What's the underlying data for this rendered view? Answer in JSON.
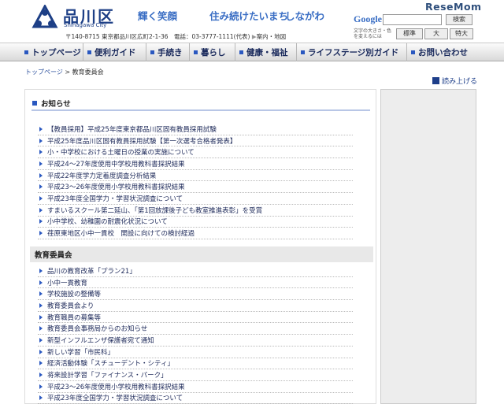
{
  "header": {
    "logo_name": "品川区",
    "logo_sub": "Shinagawa City",
    "slogan_1": "輝く笑顔",
    "slogan_2": "住み続けたいまち",
    "slogan_3": "しながわ",
    "address": "〒140-8715 東京都品川区広町2-1-36　電話：03-3777-1111(代表)",
    "address_link": "案内・地図",
    "google_label": "Google",
    "search_button": "検索",
    "font_size_label": "文字の大きさ・色を変えるには",
    "font_buttons": [
      "標準",
      "大",
      "特大"
    ],
    "watermark": "ReseMom"
  },
  "nav": {
    "items": [
      "トップページ",
      "便利ガイド",
      "手続き",
      "暮らし",
      "健康・福祉",
      "ライフステージ別ガイド",
      "お問い合わせ"
    ]
  },
  "breadcrumb": {
    "home": "トップページ",
    "separator": " > ",
    "current": "教育委員会"
  },
  "read_aloud": "読み上げる",
  "notices": {
    "title": "お知らせ",
    "items": [
      "【教員採用】平成25年度東京都品川区固有教員採用試験",
      "平成25年度品川区固有教員採用試験【第一次選考合格者発表】",
      "小・中学校における土曜日の授業の実施について",
      "平成24〜27年度使用中学校用教科書採択結果",
      "平成22年度学力定着度調査分析結果",
      "平成23〜26年度使用小学校用教科書採択結果",
      "平成23年度全国学力・学習状況調査について",
      "すまいるスクール第二延山、「第1回放課後子ども教室推進表彰」を受賞",
      "小中学校、幼稚園の耐震化状況について",
      "荏原東地区小中一貫校　開設に向けての検討経過"
    ]
  },
  "committee": {
    "title": "教育委員会",
    "items": [
      "品川の教育改革「プラン21」",
      "小中一貫教育",
      "学校施設の整備等",
      "教育委員会より",
      "教育職員の募集等",
      "教育委員会事務局からのお知らせ",
      "新型インフルエンザ保護者宛て通知",
      "新しい学習「市民科」",
      "経済活動体験「スチューデント・シティ」",
      "将来設計学習「ファイナンス・パーク」",
      "平成23〜26年度使用小学校用教科書採択結果",
      "平成23年度全国学力・学習状況調査について"
    ]
  },
  "colors": {
    "brand": "#1d3f86",
    "accent": "#2a58c0",
    "slogan": "#3a6ec4"
  }
}
